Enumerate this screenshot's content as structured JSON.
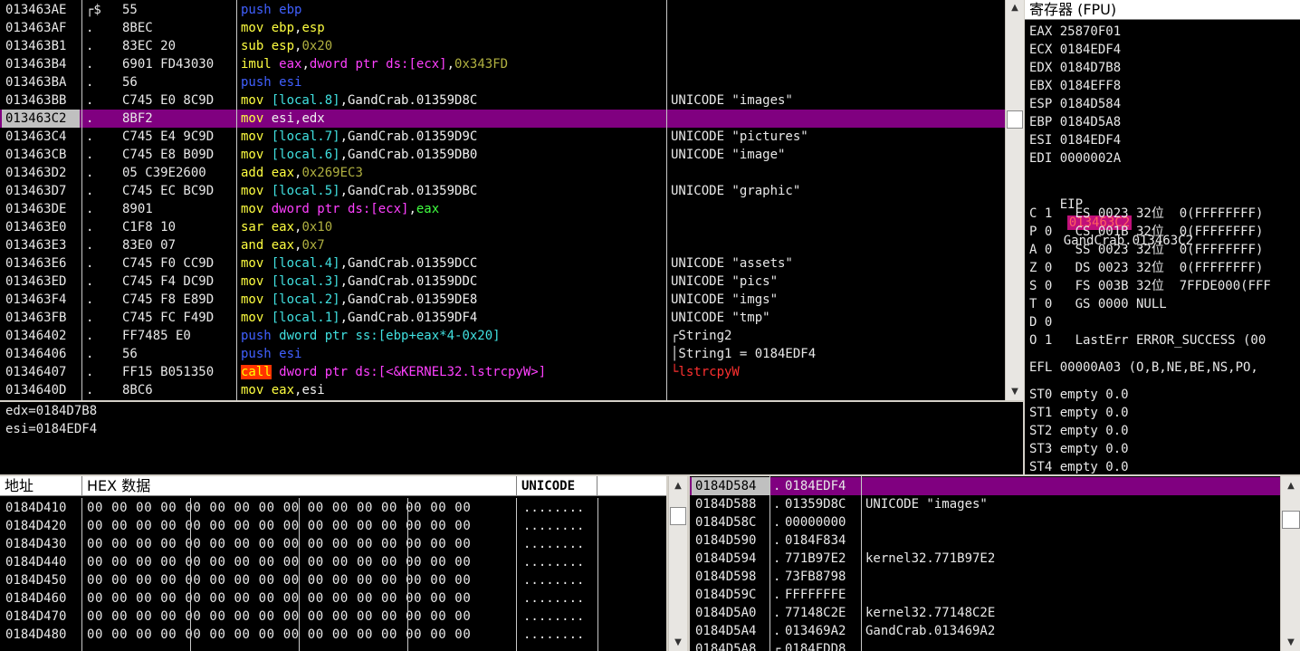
{
  "disasm": {
    "rows": [
      {
        "addr": "013463AE",
        "mark": "┌$",
        "hex": "55",
        "comment": ""
      },
      {
        "addr": "013463AF",
        "mark": ".",
        "hex": "8BEC",
        "comment": ""
      },
      {
        "addr": "013463B1",
        "mark": ".",
        "hex": "83EC 20",
        "comment": ""
      },
      {
        "addr": "013463B4",
        "mark": ".",
        "hex": "6901 FD43030",
        "comment": ""
      },
      {
        "addr": "013463BA",
        "mark": ".",
        "hex": "56",
        "comment": ""
      },
      {
        "addr": "013463BB",
        "mark": ".",
        "hex": "C745 E0 8C9D",
        "comment": "UNICODE \"images\""
      },
      {
        "addr": "013463C2",
        "mark": ".",
        "hex": "8BF2",
        "comment": ""
      },
      {
        "addr": "013463C4",
        "mark": ".",
        "hex": "C745 E4 9C9D",
        "comment": "UNICODE \"pictures\""
      },
      {
        "addr": "013463CB",
        "mark": ".",
        "hex": "C745 E8 B09D",
        "comment": "UNICODE \"image\""
      },
      {
        "addr": "013463D2",
        "mark": ".",
        "hex": "05 C39E2600",
        "comment": ""
      },
      {
        "addr": "013463D7",
        "mark": ".",
        "hex": "C745 EC BC9D",
        "comment": "UNICODE \"graphic\""
      },
      {
        "addr": "013463DE",
        "mark": ".",
        "hex": "8901",
        "comment": ""
      },
      {
        "addr": "013463E0",
        "mark": ".",
        "hex": "C1F8 10",
        "comment": ""
      },
      {
        "addr": "013463E3",
        "mark": ".",
        "hex": "83E0 07",
        "comment": ""
      },
      {
        "addr": "013463E6",
        "mark": ".",
        "hex": "C745 F0 CC9D",
        "comment": "UNICODE \"assets\""
      },
      {
        "addr": "013463ED",
        "mark": ".",
        "hex": "C745 F4 DC9D",
        "comment": "UNICODE \"pics\""
      },
      {
        "addr": "013463F4",
        "mark": ".",
        "hex": "C745 F8 E89D",
        "comment": "UNICODE \"imgs\""
      },
      {
        "addr": "013463FB",
        "mark": ".",
        "hex": "C745 FC F49D",
        "comment": "UNICODE \"tmp\""
      },
      {
        "addr": "01346402",
        "mark": ".",
        "hex": "FF7485 E0",
        "comment": "┌String2"
      },
      {
        "addr": "01346406",
        "mark": ".",
        "hex": "56",
        "comment": "│String1 = 0184EDF4"
      },
      {
        "addr": "01346407",
        "mark": ".",
        "hex": "FF15 B051350",
        "comment": "└lstrcpyW"
      },
      {
        "addr": "0134640D",
        "mark": ".",
        "hex": "8BC6",
        "comment": ""
      }
    ],
    "asm": [
      [
        {
          "t": "push ",
          "c": "c-blue"
        },
        {
          "t": "ebp",
          "c": "c-blue"
        }
      ],
      [
        {
          "t": "mov ",
          "c": "c-yellow"
        },
        {
          "t": "ebp",
          "c": "c-yellow"
        },
        {
          "t": ",",
          "c": "c-white"
        },
        {
          "t": "esp",
          "c": "c-yellow"
        }
      ],
      [
        {
          "t": "sub ",
          "c": "c-yellow"
        },
        {
          "t": "esp",
          "c": "c-yellow"
        },
        {
          "t": ",",
          "c": "c-white"
        },
        {
          "t": "0x20",
          "c": "c-olive"
        }
      ],
      [
        {
          "t": "imul ",
          "c": "c-yellow"
        },
        {
          "t": "eax",
          "c": "c-mag"
        },
        {
          "t": ",",
          "c": "c-white"
        },
        {
          "t": "dword ptr ds:[ecx]",
          "c": "c-mag"
        },
        {
          "t": ",",
          "c": "c-white"
        },
        {
          "t": "0x343FD",
          "c": "c-olive"
        }
      ],
      [
        {
          "t": "push ",
          "c": "c-blue"
        },
        {
          "t": "esi",
          "c": "c-blue"
        }
      ],
      [
        {
          "t": "mov ",
          "c": "c-yellow"
        },
        {
          "t": "[local.8]",
          "c": "c-cyan"
        },
        {
          "t": ",GandCrab.01359D8C",
          "c": "c-white"
        }
      ],
      [
        {
          "t": "mov ",
          "c": "c-yellow"
        },
        {
          "t": "esi",
          "c": "c-white"
        },
        {
          "t": ",",
          "c": "c-white"
        },
        {
          "t": "edx",
          "c": "c-white"
        }
      ],
      [
        {
          "t": "mov ",
          "c": "c-yellow"
        },
        {
          "t": "[local.7]",
          "c": "c-cyan"
        },
        {
          "t": ",GandCrab.01359D9C",
          "c": "c-white"
        }
      ],
      [
        {
          "t": "mov ",
          "c": "c-yellow"
        },
        {
          "t": "[local.6]",
          "c": "c-cyan"
        },
        {
          "t": ",GandCrab.01359DB0",
          "c": "c-white"
        }
      ],
      [
        {
          "t": "add ",
          "c": "c-yellow"
        },
        {
          "t": "eax",
          "c": "c-yellow"
        },
        {
          "t": ",",
          "c": "c-white"
        },
        {
          "t": "0x269EC3",
          "c": "c-olive"
        }
      ],
      [
        {
          "t": "mov ",
          "c": "c-yellow"
        },
        {
          "t": "[local.5]",
          "c": "c-cyan"
        },
        {
          "t": ",GandCrab.01359DBC",
          "c": "c-white"
        }
      ],
      [
        {
          "t": "mov ",
          "c": "c-yellow"
        },
        {
          "t": "dword ptr ds:[ecx]",
          "c": "c-mag"
        },
        {
          "t": ",",
          "c": "c-white"
        },
        {
          "t": "eax",
          "c": "c-green"
        }
      ],
      [
        {
          "t": "sar ",
          "c": "c-yellow"
        },
        {
          "t": "eax",
          "c": "c-yellow"
        },
        {
          "t": ",",
          "c": "c-white"
        },
        {
          "t": "0x10",
          "c": "c-olive"
        }
      ],
      [
        {
          "t": "and ",
          "c": "c-yellow"
        },
        {
          "t": "eax",
          "c": "c-yellow"
        },
        {
          "t": ",",
          "c": "c-white"
        },
        {
          "t": "0x7",
          "c": "c-olive"
        }
      ],
      [
        {
          "t": "mov ",
          "c": "c-yellow"
        },
        {
          "t": "[local.4]",
          "c": "c-cyan"
        },
        {
          "t": ",GandCrab.01359DCC",
          "c": "c-white"
        }
      ],
      [
        {
          "t": "mov ",
          "c": "c-yellow"
        },
        {
          "t": "[local.3]",
          "c": "c-cyan"
        },
        {
          "t": ",GandCrab.01359DDC",
          "c": "c-white"
        }
      ],
      [
        {
          "t": "mov ",
          "c": "c-yellow"
        },
        {
          "t": "[local.2]",
          "c": "c-cyan"
        },
        {
          "t": ",GandCrab.01359DE8",
          "c": "c-white"
        }
      ],
      [
        {
          "t": "mov ",
          "c": "c-yellow"
        },
        {
          "t": "[local.1]",
          "c": "c-cyan"
        },
        {
          "t": ",GandCrab.01359DF4",
          "c": "c-white"
        }
      ],
      [
        {
          "t": "push ",
          "c": "c-blue"
        },
        {
          "t": "dword ptr ss:[ebp+eax*4-0x20]",
          "c": "c-cyan"
        }
      ],
      [
        {
          "t": "push ",
          "c": "c-blue"
        },
        {
          "t": "esi",
          "c": "c-blue"
        }
      ],
      [
        {
          "t": "call",
          "c": "call-bg"
        },
        {
          "t": " dword ptr ds:[<&KERNEL32.lstrcpyW>]",
          "c": "c-mag"
        }
      ],
      [
        {
          "t": "mov ",
          "c": "c-yellow"
        },
        {
          "t": "eax",
          "c": "c-yellow"
        },
        {
          "t": ",",
          "c": "c-white"
        },
        {
          "t": "esi",
          "c": "c-white"
        }
      ]
    ],
    "selected_index": 6,
    "red_comment_index": 20
  },
  "info": {
    "lines": [
      "edx=0184D7B8",
      "esi=0184EDF4"
    ]
  },
  "registers": {
    "title": "寄存器 (FPU)",
    "gp": [
      "EAX 25870F01",
      "ECX 0184EDF4",
      "EDX 0184D7B8",
      "EBX 0184EFF8",
      "ESP 0184D584",
      "EBP 0184D5A8",
      "ESI 0184EDF4",
      "EDI 0000002A"
    ],
    "eip_label": "EIP",
    "eip_value": "013463C2",
    "eip_symbol": "GandCrab.013463C2",
    "flags": [
      "C 1   ES 0023 32位  0(FFFFFFFF)",
      "P 0   CS 001B 32位  0(FFFFFFFF)",
      "A 0   SS 0023 32位  0(FFFFFFFF)",
      "Z 0   DS 0023 32位  0(FFFFFFFF)",
      "S 0   FS 003B 32位  7FFDE000(FFF",
      "T 0   GS 0000 NULL",
      "D 0",
      "O 1   LastErr ERROR_SUCCESS (00"
    ],
    "efl": "EFL 00000A03 (O,B,NE,BE,NS,PO,",
    "fpu": [
      "ST0 empty 0.0",
      "ST1 empty 0.0",
      "ST2 empty 0.0",
      "ST3 empty 0.0",
      "ST4 empty 0.0"
    ]
  },
  "dump": {
    "headers": {
      "addr": "地址",
      "hex": "HEX 数据",
      "unicode": "UNICODE"
    },
    "rows": [
      {
        "addr": "0184D410",
        "bytes": "00 00 00 00 00 00 00 00 00 00 00 00 00 00 00 00",
        "text": "........"
      },
      {
        "addr": "0184D420",
        "bytes": "00 00 00 00 00 00 00 00 00 00 00 00 00 00 00 00",
        "text": "........"
      },
      {
        "addr": "0184D430",
        "bytes": "00 00 00 00 00 00 00 00 00 00 00 00 00 00 00 00",
        "text": "........"
      },
      {
        "addr": "0184D440",
        "bytes": "00 00 00 00 00 00 00 00 00 00 00 00 00 00 00 00",
        "text": "........"
      },
      {
        "addr": "0184D450",
        "bytes": "00 00 00 00 00 00 00 00 00 00 00 00 00 00 00 00",
        "text": "........"
      },
      {
        "addr": "0184D460",
        "bytes": "00 00 00 00 00 00 00 00 00 00 00 00 00 00 00 00",
        "text": "........"
      },
      {
        "addr": "0184D470",
        "bytes": "00 00 00 00 00 00 00 00 00 00 00 00 00 00 00 00",
        "text": "........"
      },
      {
        "addr": "0184D480",
        "bytes": "00 00 00 00 00 00 00 00 00 00 00 00 00 00 00 00",
        "text": "........"
      }
    ]
  },
  "stack": {
    "rows": [
      {
        "addr": "0184D584",
        "mark": ".",
        "val": "0184EDF4",
        "comment": ""
      },
      {
        "addr": "0184D588",
        "mark": ".",
        "val": "01359D8C",
        "comment": "UNICODE \"images\""
      },
      {
        "addr": "0184D58C",
        "mark": ".",
        "val": "00000000",
        "comment": ""
      },
      {
        "addr": "0184D590",
        "mark": ".",
        "val": "0184F834",
        "comment": ""
      },
      {
        "addr": "0184D594",
        "mark": ".",
        "val": "771B97E2",
        "comment": "kernel32.771B97E2"
      },
      {
        "addr": "0184D598",
        "mark": ".",
        "val": "73FB8798",
        "comment": ""
      },
      {
        "addr": "0184D59C",
        "mark": ".",
        "val": "FFFFFFFE",
        "comment": ""
      },
      {
        "addr": "0184D5A0",
        "mark": ".",
        "val": "77148C2E",
        "comment": "kernel32.77148C2E"
      },
      {
        "addr": "0184D5A4",
        "mark": ".",
        "val": "013469A2",
        "comment": "GandCrab.013469A2"
      },
      {
        "addr": "0184D5A8",
        "mark": "┌",
        "val": "0184FDD8",
        "comment": ""
      }
    ]
  },
  "scroll": {
    "up": "▲",
    "down": "▼"
  },
  "colors": {
    "selection": "#800080",
    "background": "#000000",
    "eip_highlight": "#c0107a"
  }
}
